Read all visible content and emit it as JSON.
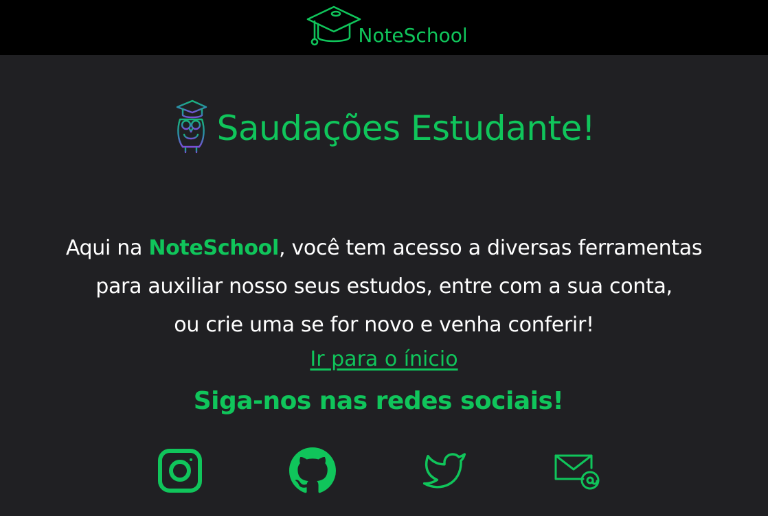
{
  "header": {
    "brand_name": "NoteSchool",
    "logo_icon": "graduation-cap-icon"
  },
  "greeting": {
    "icon": "owl-graduate-icon",
    "title": "Saudações Estudante!"
  },
  "intro": {
    "line1_prefix": "Aqui na ",
    "line1_brand": "NoteSchool",
    "line1_suffix": ", você tem acesso a diversas ferramentas",
    "line2": "para auxiliar nosso seus estudos, entre com a sua conta,",
    "line3": "ou crie uma se for novo e venha conferir!"
  },
  "home_link": {
    "label": "Ir para o ínicio"
  },
  "social": {
    "title": "Siga-nos nas redes sociais!",
    "items": [
      {
        "icon": "instagram-icon"
      },
      {
        "icon": "github-icon"
      },
      {
        "icon": "twitter-icon"
      },
      {
        "icon": "email-icon"
      }
    ]
  },
  "colors": {
    "accent": "#10c55b",
    "header_bg": "#000000",
    "panel_bg": "#202023",
    "text": "#ffffff",
    "owl_gradient_start": "#18b57a",
    "owl_gradient_end": "#7a4fd6"
  }
}
